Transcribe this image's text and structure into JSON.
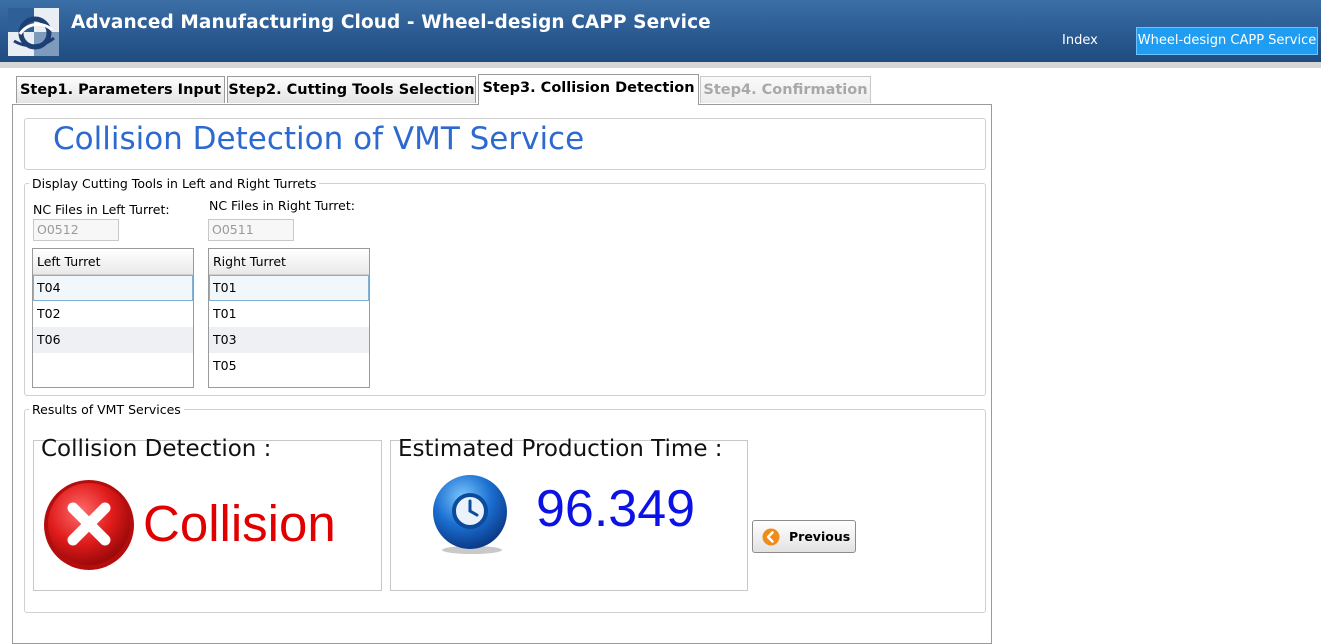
{
  "header": {
    "title": "Advanced Manufacturing Cloud - Wheel-design CAPP Service",
    "nav": [
      {
        "label": "Index"
      },
      {
        "label": "Wheel-design CAPP Service"
      }
    ]
  },
  "tabs": [
    {
      "label": "Step1. Parameters Input",
      "state": "normal"
    },
    {
      "label": "Step2. Cutting Tools Selection",
      "state": "normal"
    },
    {
      "label": "Step3. Collision Detection",
      "state": "active"
    },
    {
      "label": "Step4. Confirmation",
      "state": "disabled"
    }
  ],
  "page": {
    "title": "Collision Detection of VMT Service"
  },
  "turrets": {
    "legend": "Display Cutting Tools in Left and Right Turrets",
    "left_label": "NC Files in Left Turret:",
    "right_label": "NC Files in Right Turret:",
    "left_value": "O0512",
    "right_value": "O0511",
    "left_grid": {
      "header": "Left Turret",
      "rows": [
        "T04",
        "T02",
        "T06"
      ]
    },
    "right_grid": {
      "header": "Right Turret",
      "rows": [
        "T01",
        "T01",
        "T03",
        "T05"
      ]
    }
  },
  "results": {
    "legend": "Results of VMT Services",
    "collision_title": "Collision Detection :",
    "collision_value": "Collision",
    "time_title": "Estimated Production Time :",
    "time_value": "96.349"
  },
  "actions": {
    "previous_label": "Previous"
  },
  "colors": {
    "header": "#2a5a91",
    "accent": "#1e9df2",
    "title_blue": "#2d6ad0",
    "collision_red": "#e00000",
    "time_blue": "#0a12e6"
  },
  "icons": [
    "app-logo-icon",
    "error-x-icon",
    "clock-icon",
    "arrow-left-icon"
  ]
}
